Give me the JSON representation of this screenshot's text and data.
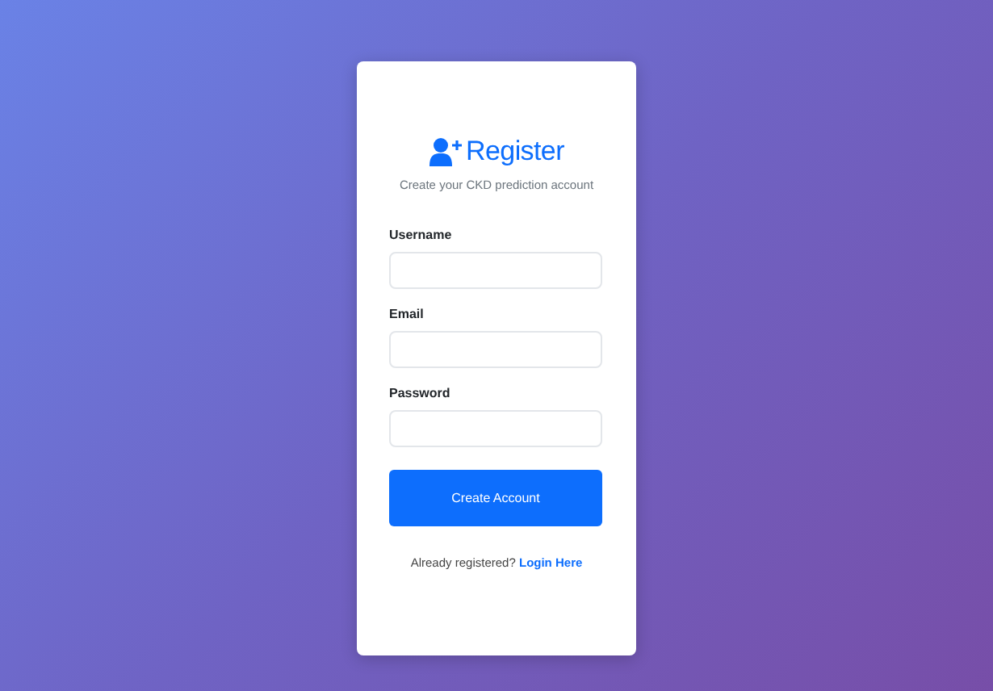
{
  "header": {
    "title": "Register",
    "subtitle": "Create your CKD prediction account"
  },
  "fields": [
    {
      "label": "Username"
    },
    {
      "label": "Email"
    },
    {
      "label": "Password"
    }
  ],
  "submit_button": "Create Account",
  "footer": {
    "text": "Already registered?",
    "link": "Login Here"
  }
}
